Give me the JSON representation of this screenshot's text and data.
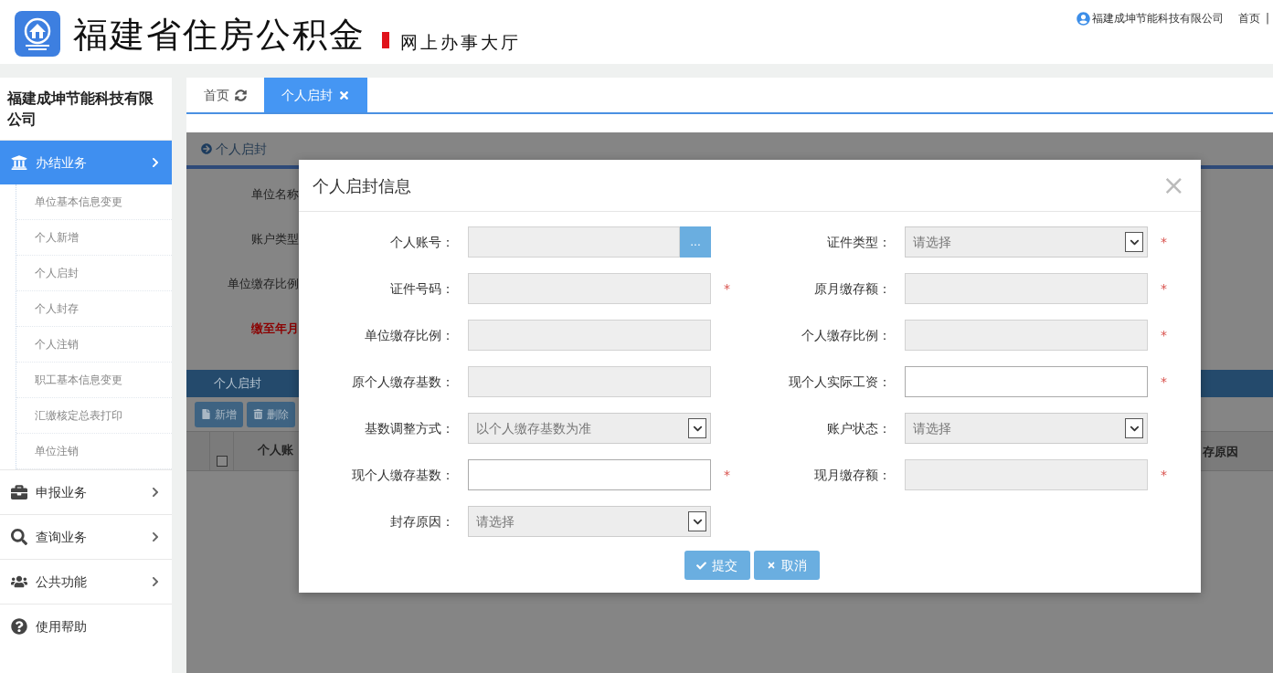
{
  "header": {
    "title": "福建省住房公积金",
    "subtitle": "网上办事大厅",
    "user": "福建成坤节能科技有限公司",
    "links": [
      "首页",
      "|"
    ]
  },
  "sidebar": {
    "company": "福建成坤节能科技有限公司",
    "menus": [
      {
        "label": "办结业务",
        "selected": true,
        "expandable": true,
        "children": [
          {
            "label": "单位基本信息变更"
          },
          {
            "label": "个人新增"
          },
          {
            "label": "个人启封"
          },
          {
            "label": "个人封存"
          },
          {
            "label": "个人注销"
          },
          {
            "label": "职工基本信息变更"
          },
          {
            "label": "汇缴核定总表打印"
          },
          {
            "label": "单位注销"
          }
        ]
      },
      {
        "label": "申报业务",
        "selected": false,
        "expandable": true
      },
      {
        "label": "查询业务",
        "selected": false,
        "expandable": true
      },
      {
        "label": "公共功能",
        "selected": false,
        "expandable": true
      },
      {
        "label": "使用帮助",
        "selected": false,
        "expandable": false
      }
    ]
  },
  "tabs": [
    {
      "label": "首页",
      "selected": false,
      "closable": false
    },
    {
      "label": "个人启封",
      "selected": true,
      "closable": true
    }
  ],
  "page": {
    "title": "个人启封",
    "form_labels": [
      {
        "label": "单位名称",
        "highlight": false
      },
      {
        "label": "账户类型",
        "highlight": false
      },
      {
        "label": "单位缴存比例",
        "highlight": false
      },
      {
        "label": "缴至年月",
        "highlight": true
      }
    ],
    "grid": {
      "title": "个人启封",
      "buttons": [
        "新增",
        "删除"
      ],
      "select_all_checked": false,
      "column_left": "个人账",
      "column_right": "存原因"
    }
  },
  "modal": {
    "title": "个人启封信息",
    "close": "×",
    "rows": [
      {
        "left": {
          "label": "个人账号：",
          "kind": "lookup",
          "button_label": "...",
          "disabled": true
        },
        "right": {
          "label": "证件类型：",
          "kind": "select",
          "value": "请选择",
          "disabled": true,
          "mark": "*"
        }
      },
      {
        "left": {
          "label": "证件号码：",
          "kind": "text",
          "disabled": true,
          "mark": "*"
        },
        "right": {
          "label": "原月缴存额：",
          "kind": "text",
          "disabled": true,
          "mark": "*"
        }
      },
      {
        "left": {
          "label": "单位缴存比例：",
          "kind": "text",
          "disabled": true
        },
        "right": {
          "label": "个人缴存比例：",
          "kind": "text",
          "disabled": true,
          "mark": "*"
        }
      },
      {
        "left": {
          "label": "原个人缴存基数：",
          "kind": "text",
          "disabled": true
        },
        "right": {
          "label": "现个人实际工资：",
          "kind": "text",
          "disabled": false,
          "mark": "*"
        }
      },
      {
        "left": {
          "label": "基数调整方式：",
          "kind": "select",
          "value": "以个人缴存基数为准",
          "disabled": true
        },
        "right": {
          "label": "账户状态：",
          "kind": "select",
          "value": "请选择",
          "disabled": true
        }
      },
      {
        "left": {
          "label": "现个人缴存基数：",
          "kind": "text",
          "disabled": false,
          "mark": "*"
        },
        "right": {
          "label": "现月缴存额：",
          "kind": "text",
          "disabled": true,
          "mark": "*"
        }
      },
      {
        "left": {
          "label": "封存原因：",
          "kind": "select",
          "value": "请选择",
          "disabled": true
        }
      }
    ],
    "buttons": [
      {
        "label": "提交",
        "kind": "submit"
      },
      {
        "label": "取消",
        "kind": "cancel"
      }
    ]
  }
}
